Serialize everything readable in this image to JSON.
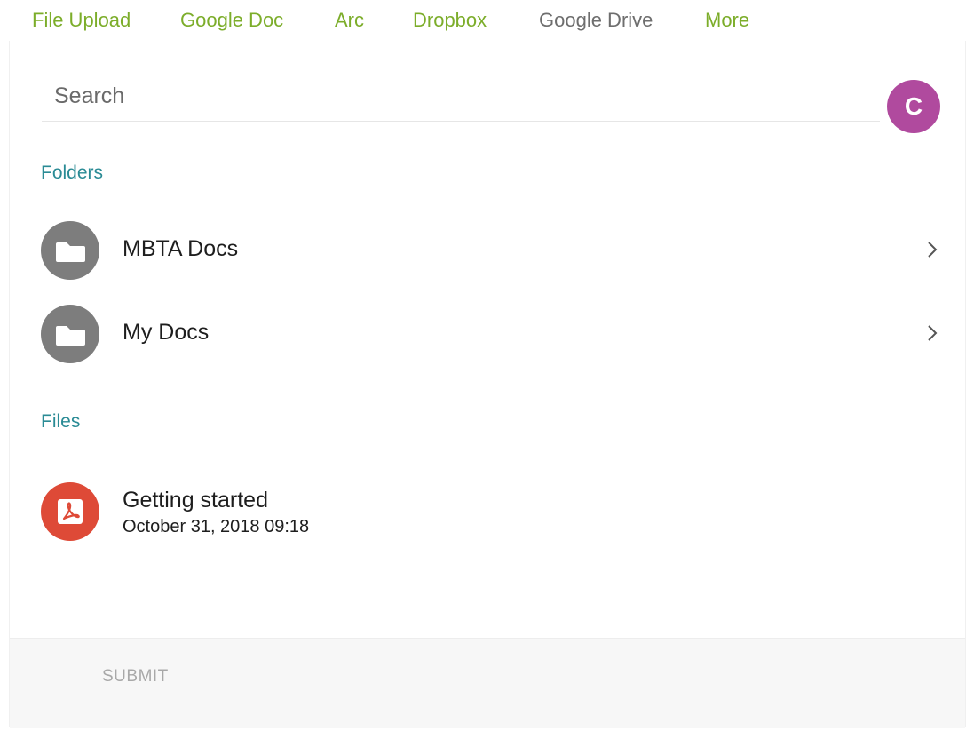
{
  "tabs": [
    {
      "label": "File Upload",
      "active": false
    },
    {
      "label": "Google Doc",
      "active": false
    },
    {
      "label": "Arc",
      "active": false
    },
    {
      "label": "Dropbox",
      "active": false
    },
    {
      "label": "Google Drive",
      "active": true
    },
    {
      "label": "More",
      "active": false
    }
  ],
  "search": {
    "placeholder": "Search",
    "value": ""
  },
  "user": {
    "avatar_initial": "C",
    "avatar_color": "#b04a9e"
  },
  "folders": {
    "heading": "Folders",
    "items": [
      {
        "name": "MBTA Docs",
        "icon": "folder-icon"
      },
      {
        "name": "My Docs",
        "icon": "folder-icon"
      }
    ]
  },
  "files": {
    "heading": "Files",
    "items": [
      {
        "name": "Getting started",
        "date": "October 31, 2018 09:18",
        "icon": "pdf-icon"
      }
    ]
  },
  "footer": {
    "submit_label": "SUBMIT"
  },
  "colors": {
    "tab_accent": "#7cad2a",
    "tab_active": "#6e6e6e",
    "section_heading": "#2a8b95",
    "folder_icon_bg": "#7d7d7d",
    "pdf_icon_bg": "#de4a37"
  }
}
